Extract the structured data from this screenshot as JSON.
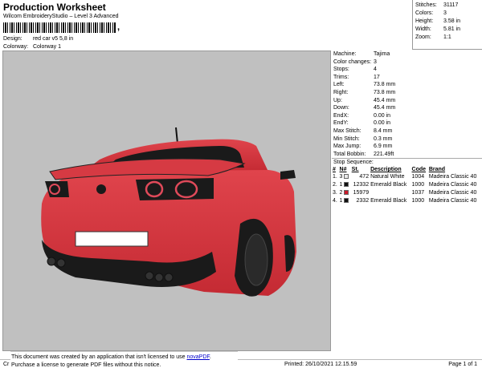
{
  "header": {
    "title": "Production Worksheet",
    "subtitle": "Wilcom EmbroideryStudio – Level 3 Advanced",
    "barcode_mark": ",",
    "design_label": "Design:",
    "design_value": "red car v5 5,8 in",
    "colorway_label": "Colorway:",
    "colorway_value": "Colorway 1"
  },
  "stats": {
    "stitches_label": "Stitches:",
    "stitches": "31117",
    "colors_label": "Colors:",
    "colors": "3",
    "height_label": "Height:",
    "height": "3.58 in",
    "width_label": "Width:",
    "width": "5.81 in",
    "zoom_label": "Zoom:",
    "zoom": "1:1"
  },
  "machine_info": [
    {
      "k": "Machine:",
      "v": "Tajima"
    },
    {
      "k": "Color changes:",
      "v": "3"
    },
    {
      "k": "Stops:",
      "v": "4"
    },
    {
      "k": "Trims:",
      "v": "17"
    },
    {
      "k": "Left:",
      "v": "73.8 mm"
    },
    {
      "k": "Right:",
      "v": "73.8 mm"
    },
    {
      "k": "Up:",
      "v": "45.4 mm"
    },
    {
      "k": "Down:",
      "v": "45.4 mm"
    },
    {
      "k": "EndX:",
      "v": "0.00 in"
    },
    {
      "k": "EndY:",
      "v": "0.00 in"
    },
    {
      "k": "Max Stitch:",
      "v": "8.4 mm"
    },
    {
      "k": "Min Stitch:",
      "v": "0.3 mm"
    },
    {
      "k": "Max Jump:",
      "v": "6.9 mm"
    },
    {
      "k": "Total Bobbin:",
      "v": "221.49ft"
    }
  ],
  "stop_sequence": {
    "label": "Stop Sequence:",
    "headers": [
      "#",
      "N#",
      "St.",
      "Description",
      "Code",
      "Brand"
    ],
    "rows": [
      {
        "n": "1.",
        "nn": "3",
        "color": "#e8e8e8",
        "st": "472",
        "desc": "Natural White",
        "code": "1004",
        "brand": "Madeira Classic 40"
      },
      {
        "n": "2.",
        "nn": "1",
        "color": "#111111",
        "st": "12332",
        "desc": "Emerald Black",
        "code": "1000",
        "brand": "Madeira Classic 40"
      },
      {
        "n": "3.",
        "nn": "2",
        "color": "#cc1a2a",
        "st": "15979",
        "desc": "",
        "code": "1037",
        "brand": "Madeira Classic 40"
      },
      {
        "n": "4.",
        "nn": "1",
        "color": "#111111",
        "st": "2332",
        "desc": "Emerald Black",
        "code": "1000",
        "brand": "Madeira Classic 40"
      }
    ]
  },
  "nova": {
    "line1": "This document was created by an application that isn't licensed to use ",
    "link": "novaPDF",
    "line1_end": ".",
    "line2": "Purchase a license to generate PDF files without this notice."
  },
  "footer": {
    "left": "Cr",
    "printed": "Printed: 26/10/2021 12.15.59",
    "page": "Page 1 of 1"
  }
}
